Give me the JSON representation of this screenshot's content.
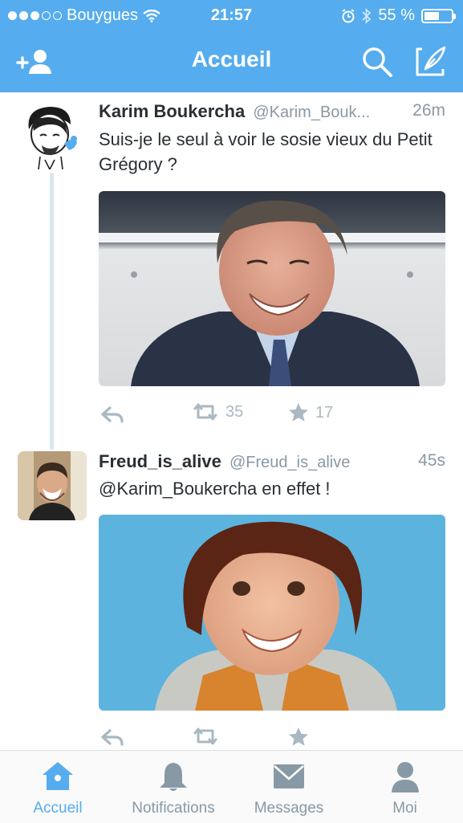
{
  "status_bar": {
    "carrier": "Bouygues",
    "time": "21:57",
    "battery": "55 %",
    "battery_level": 0.55
  },
  "nav": {
    "title": "Accueil",
    "add_user_icon": "add-user-icon",
    "search_icon": "search-icon",
    "compose_icon": "compose-icon"
  },
  "tweets": [
    {
      "name": "Karim Boukercha",
      "handle": "@Karim_Bouk...",
      "time": "26m",
      "text": "Suis-je le seul à voir le sosie vieux du Petit Grégory ?",
      "retweets": "35",
      "favorites": "17"
    },
    {
      "name": "Freud_is_alive",
      "handle": "@Freud_is_alive",
      "time": "45s",
      "text": "@Karim_Boukercha en effet !"
    }
  ],
  "tabs": [
    {
      "label": "Accueil",
      "icon": "home-icon",
      "active": true
    },
    {
      "label": "Notifications",
      "icon": "bell-icon",
      "active": false
    },
    {
      "label": "Messages",
      "icon": "envelope-icon",
      "active": false
    },
    {
      "label": "Moi",
      "icon": "person-icon",
      "active": false
    }
  ],
  "colors": {
    "brand": "#55acee",
    "muted": "#8899a6",
    "action": "#aab8c2"
  }
}
